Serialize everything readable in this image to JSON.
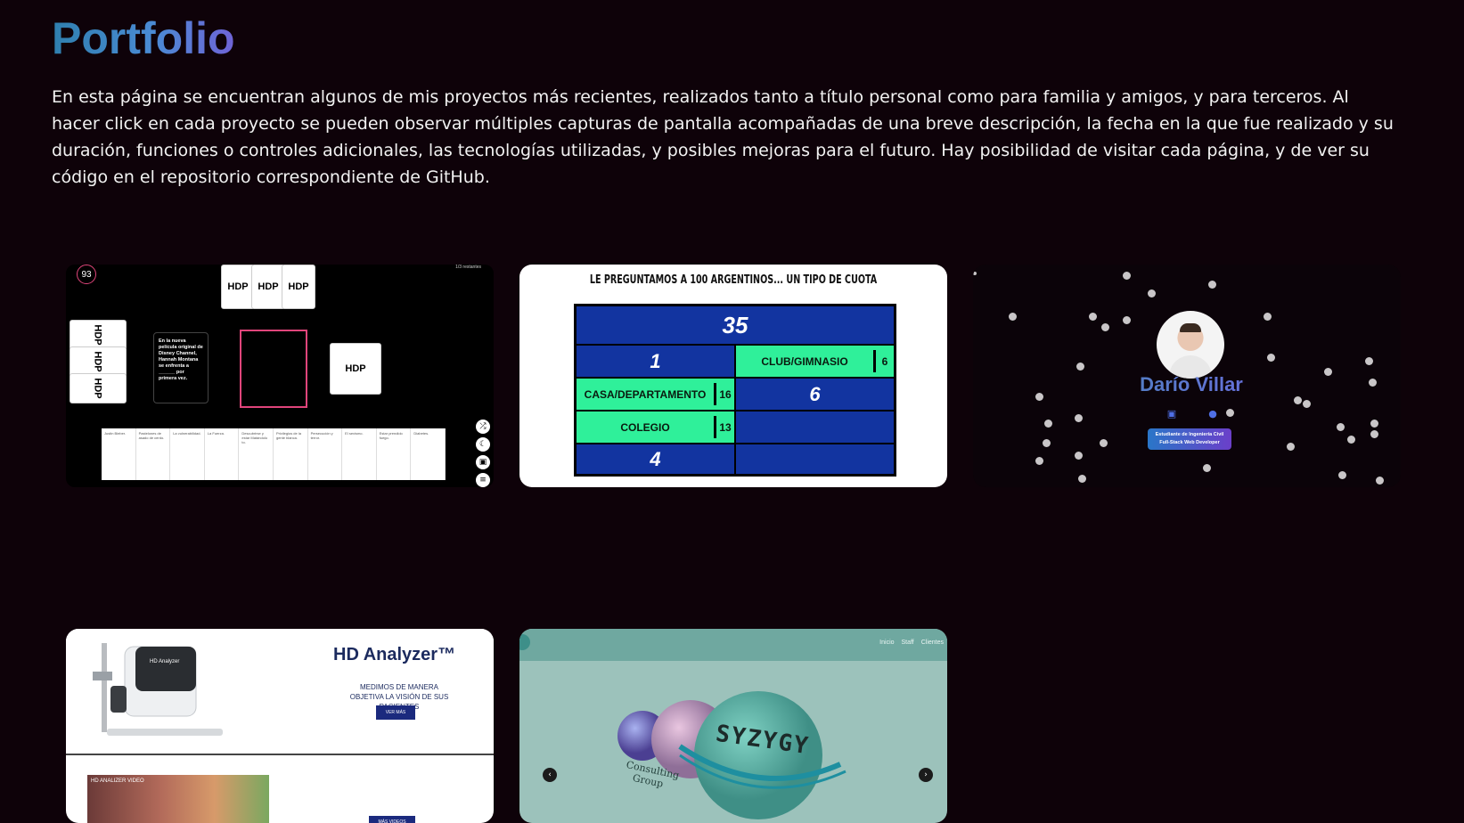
{
  "page": {
    "title": "Portfolio",
    "intro": "En esta página se encuentran algunos de mis proyectos más recientes, realizados tanto a título personal como para familia y amigos, y para terceros. Al hacer click en cada proyecto se pueden observar múltiples capturas de pantalla acompañadas de una breve descripción, la fecha en la que fue realizado y su duración, funciones o controles adicionales, las tecnologías utilizadas, y posibles mejoras para el futuro. Hay posibilidad de visitar cada página, y de ver su código en el repositorio correspondiente de GitHub."
  },
  "colors": {
    "background": "#0e0209",
    "title_gradient_start": "#2f7fae",
    "title_gradient_end": "#6f63d6"
  },
  "cards": {
    "hdp": {
      "counter": "93",
      "status": "1/3 restantes",
      "top_cards": [
        "HDP",
        "HDP",
        "HDP"
      ],
      "left_cards": [
        "HDP",
        "HDP",
        "HDP"
      ],
      "right_card": "HDP",
      "black_card": "En la nueva película original de Disney Channel, Hannah Montana se enfrenta a ______ por primera vez.",
      "hand": [
        "Justin Bieber.",
        "Pastelones de asado de cerdo.",
        "La vulnerabilidad.",
        "La Fuerza.",
        "Descubrirse y estar Matándolo to.",
        "Privilegios de la gente blanca.",
        "Persecución y terror.",
        "El sexismo.",
        "Estar prendido fuego.",
        "Diabetes."
      ],
      "side_icons": [
        "shuffle-icon",
        "moon-icon",
        "robot-icon",
        "menu-icon"
      ]
    },
    "quiz": {
      "question": "LE PREGUNTAMOS A 100 ARGENTINOS... UN TIPO DE CUOTA",
      "score": "35",
      "left_number": "1",
      "answer_1": "CLUB/GIMNASIO",
      "answer_1_points": "6",
      "answer_2": "CASA/DEPARTAMENTO",
      "answer_2_points": "16",
      "right_number": "6",
      "answer_3": "COLEGIO",
      "answer_3_points": "13",
      "bottom_number": "4"
    },
    "profile": {
      "name": "Darío Villar",
      "badge_line_1": "Estudiante de Ingeniería Civil",
      "badge_line_2": "Full-Stack Web Developer",
      "icons": [
        "linkedin-icon",
        "github-icon"
      ]
    },
    "hd_analyzer": {
      "heading": "HD Analyzer™",
      "tagline": "MEDIMOS DE MANERA OBJETIVA LA VISIÓN DE SUS PACIENTES",
      "button": "VER MÁS",
      "video_title": "HD ANALIZER VIDEO",
      "button_2": "MÁS VIDEOS"
    },
    "syzygy": {
      "nav": [
        "Inicio",
        "Staff",
        "Clientes"
      ],
      "brand": "SYZYGY",
      "sub_1": "Consulting",
      "sub_2": "Group",
      "prev": "‹",
      "next": "›"
    }
  }
}
